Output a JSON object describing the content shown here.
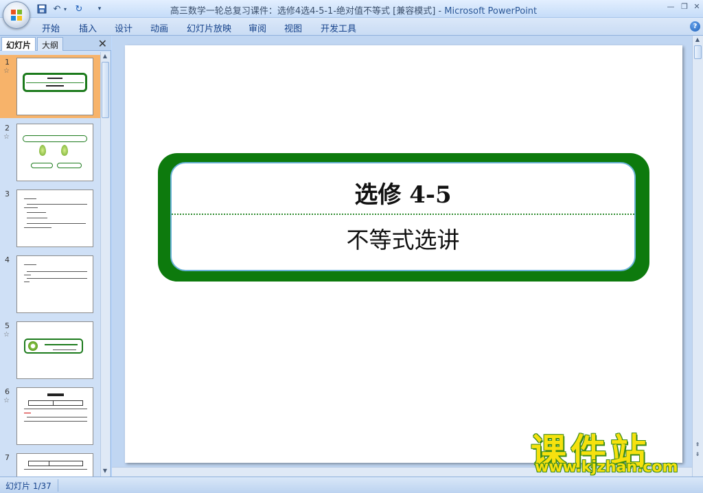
{
  "window": {
    "title": "高三数学一轮总复习课件：选修4选4-5-1-绝对值不等式 [兼容模式]",
    "title_sep": " - ",
    "app_name": "Microsoft PowerPoint"
  },
  "quick_access": {
    "save_icon": "save-icon",
    "undo_icon": "undo-icon",
    "redo_icon": "redo-icon",
    "customize_icon": "customize-icon"
  },
  "ribbon": {
    "tabs": [
      "开始",
      "插入",
      "设计",
      "动画",
      "幻灯片放映",
      "审阅",
      "视图",
      "开发工具"
    ]
  },
  "slides_pane": {
    "tab_slides": "幻灯片",
    "tab_outline": "大纲",
    "close_glyph": "✕",
    "thumbnails": [
      {
        "num": "1",
        "selected": true
      },
      {
        "num": "2",
        "selected": false
      },
      {
        "num": "3",
        "selected": false
      },
      {
        "num": "4",
        "selected": false
      },
      {
        "num": "5",
        "selected": false
      },
      {
        "num": "6",
        "selected": false
      },
      {
        "num": "7",
        "selected": false
      }
    ]
  },
  "slide": {
    "title_line1": "选修 4-5",
    "title_line2": "不等式选讲"
  },
  "watermark": {
    "text": "课件站",
    "url": "www.kjzhan.com"
  },
  "status": {
    "slide_indicator": "幻灯片 1/37"
  },
  "colors": {
    "frame_green": "#0d7a0d",
    "selected_thumb": "#f7b36a",
    "watermark_yellow": "#f6e10e"
  }
}
